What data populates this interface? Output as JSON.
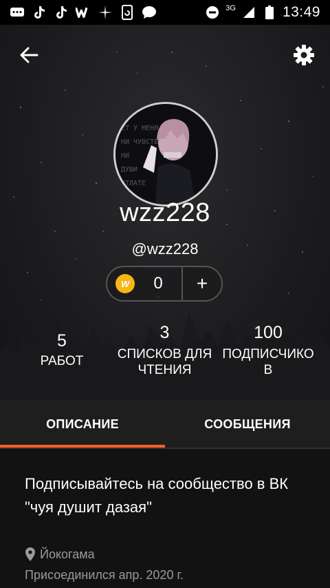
{
  "status_bar": {
    "network": "3G",
    "time": "13:49",
    "notification_icons": [
      "chat-bubbles-icon",
      "tiktok-icon",
      "tiktok-icon",
      "wattpad-icon",
      "sparkle-icon",
      "phone-sync-icon",
      "message-bubble-icon"
    ],
    "right_icons": [
      "do-not-disturb-icon",
      "signal-icon",
      "battery-icon"
    ]
  },
  "profile": {
    "username": "wzz228",
    "handle": "@wzz228",
    "coins": "0",
    "add_label": "+"
  },
  "stats": [
    {
      "value": "5",
      "label": "РАБОТ"
    },
    {
      "value": "3",
      "label_line1": "СПИСКОВ ДЛЯ",
      "label_line2": "ЧТЕНИЯ"
    },
    {
      "value": "100",
      "label_line1": "ПОДПИСЧИКО",
      "label_line2": "В"
    }
  ],
  "tabs": [
    {
      "label": "ОПИСАНИЕ",
      "active": true
    },
    {
      "label": "СООБЩЕНИЯ",
      "active": false
    }
  ],
  "about": {
    "description": "Подписывайтесь на сообщество в ВК \"чуя душит дазая\"",
    "location": "Йокогама",
    "joined": "Присоединился апр. 2020 г."
  },
  "colors": {
    "accent": "#ff6122",
    "coin": "#f6b615",
    "background": "#121212"
  }
}
